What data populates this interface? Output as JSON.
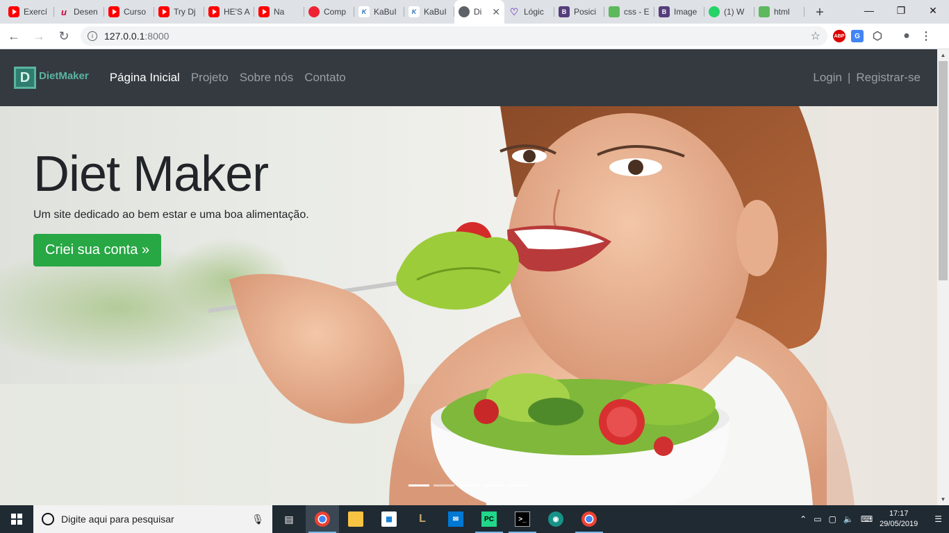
{
  "browser": {
    "tabs": [
      {
        "label": "Exercí",
        "icon": "youtube-icon",
        "kind": "yt"
      },
      {
        "label": "Desen",
        "icon": "udemy-icon",
        "kind": "udemy"
      },
      {
        "label": "Curso",
        "icon": "youtube-icon",
        "kind": "yt"
      },
      {
        "label": "Try Dj",
        "icon": "youtube-icon",
        "kind": "yt"
      },
      {
        "label": "HE'S A",
        "icon": "youtube-icon",
        "kind": "yt"
      },
      {
        "label": "Na",
        "icon": "youtube-icon",
        "kind": "yt"
      },
      {
        "label": "Comp",
        "icon": "compass-icon",
        "kind": "comp"
      },
      {
        "label": "KaBuI",
        "icon": "kabum-icon",
        "kind": "kb"
      },
      {
        "label": "KaBuI",
        "icon": "kabum-icon",
        "kind": "kb"
      },
      {
        "label": "Di",
        "icon": "globe-icon",
        "kind": "globe",
        "active": true
      },
      {
        "label": "Lógic",
        "icon": "heart-icon",
        "kind": "heart"
      },
      {
        "label": "Posici",
        "icon": "bootstrap-icon",
        "kind": "bs"
      },
      {
        "label": "css - E",
        "icon": "stackoverflow-icon",
        "kind": "sf"
      },
      {
        "label": "Image",
        "icon": "bootstrap-icon",
        "kind": "bs"
      },
      {
        "label": "(1) W",
        "icon": "whatsapp-icon",
        "kind": "wa"
      },
      {
        "label": "html",
        "icon": "stackoverflow-icon",
        "kind": "sf"
      }
    ],
    "new_tab_label": "+",
    "url_host": "127.0.0.1",
    "url_port": ":8000",
    "extensions": {
      "abp": "ABP",
      "translate": "G"
    }
  },
  "site": {
    "brand": {
      "letter": "D",
      "name": "DietMaker"
    },
    "nav": [
      "Página Inicial",
      "Projeto",
      "Sobre nós",
      "Contato"
    ],
    "auth": {
      "login": "Login",
      "separator": "|",
      "register": "Registrar-se"
    },
    "hero": {
      "title": "Diet Maker",
      "subtitle": "Um site dedicado ao bem estar e uma boa alimentação.",
      "cta": "Criei sua conta »",
      "slides": 5,
      "active_slide": 0
    }
  },
  "taskbar": {
    "search_placeholder": "Digite aqui para pesquisar",
    "time": "17:17",
    "date": "29/05/2019"
  }
}
